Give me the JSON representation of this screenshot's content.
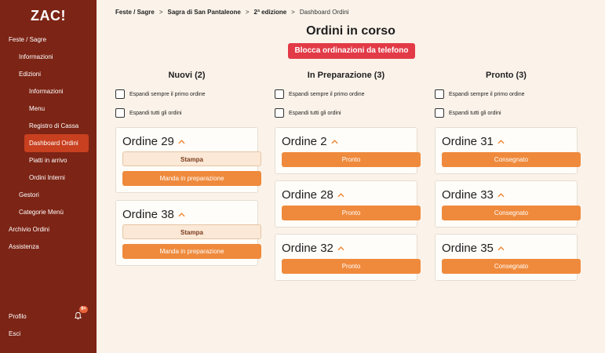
{
  "app": {
    "logo": "ZAC!"
  },
  "sidebar": {
    "items": [
      {
        "label": "Feste / Sagre"
      },
      {
        "label": "Informazioni"
      },
      {
        "label": "Edizioni"
      },
      {
        "label": "Informazioni"
      },
      {
        "label": "Menu"
      },
      {
        "label": "Registro di Cassa"
      },
      {
        "label": "Dashboard Ordini"
      },
      {
        "label": "Piatti in arrivo"
      },
      {
        "label": "Ordini Interni"
      },
      {
        "label": "Gestori"
      },
      {
        "label": "Categorie Menù"
      },
      {
        "label": "Archivio Ordini"
      },
      {
        "label": "Assistenza"
      }
    ],
    "profile": "Profilo",
    "logout": "Esci",
    "notifications_badge": "9+"
  },
  "breadcrumb": [
    "Feste / Sagre",
    "Sagra di San Pantaleone",
    "2ª edizione",
    "Dashboard Ordini"
  ],
  "breadcrumb_sep": ">",
  "page": {
    "title": "Ordini in corso",
    "block_button": "Blocca ordinazioni da telefono"
  },
  "options": {
    "expand_first": "Espandi sempre il primo ordine",
    "expand_all": "Espandi tutti gli ordini"
  },
  "columns": [
    {
      "title": "Nuovi (2)",
      "orders": [
        {
          "title": "Ordine 29",
          "print": "Stampa",
          "action": "Manda in preparazione"
        },
        {
          "title": "Ordine 38",
          "print": "Stampa",
          "action": "Manda in preparazione"
        }
      ]
    },
    {
      "title": "In Preparazione (3)",
      "orders": [
        {
          "title": "Ordine 2",
          "action": "Pronto"
        },
        {
          "title": "Ordine 28",
          "action": "Pronto"
        },
        {
          "title": "Ordine 32",
          "action": "Pronto"
        }
      ]
    },
    {
      "title": "Pronto (3)",
      "orders": [
        {
          "title": "Ordine 31",
          "action": "Consegnato"
        },
        {
          "title": "Ordine 33",
          "action": "Consegnato"
        },
        {
          "title": "Ordine 35",
          "action": "Consegnato"
        }
      ]
    }
  ],
  "colors": {
    "sidebar": "#7c2415",
    "active": "#c8401f",
    "primary": "#ef8a3c",
    "danger": "#e23a46",
    "background": "#fbf3ea"
  }
}
